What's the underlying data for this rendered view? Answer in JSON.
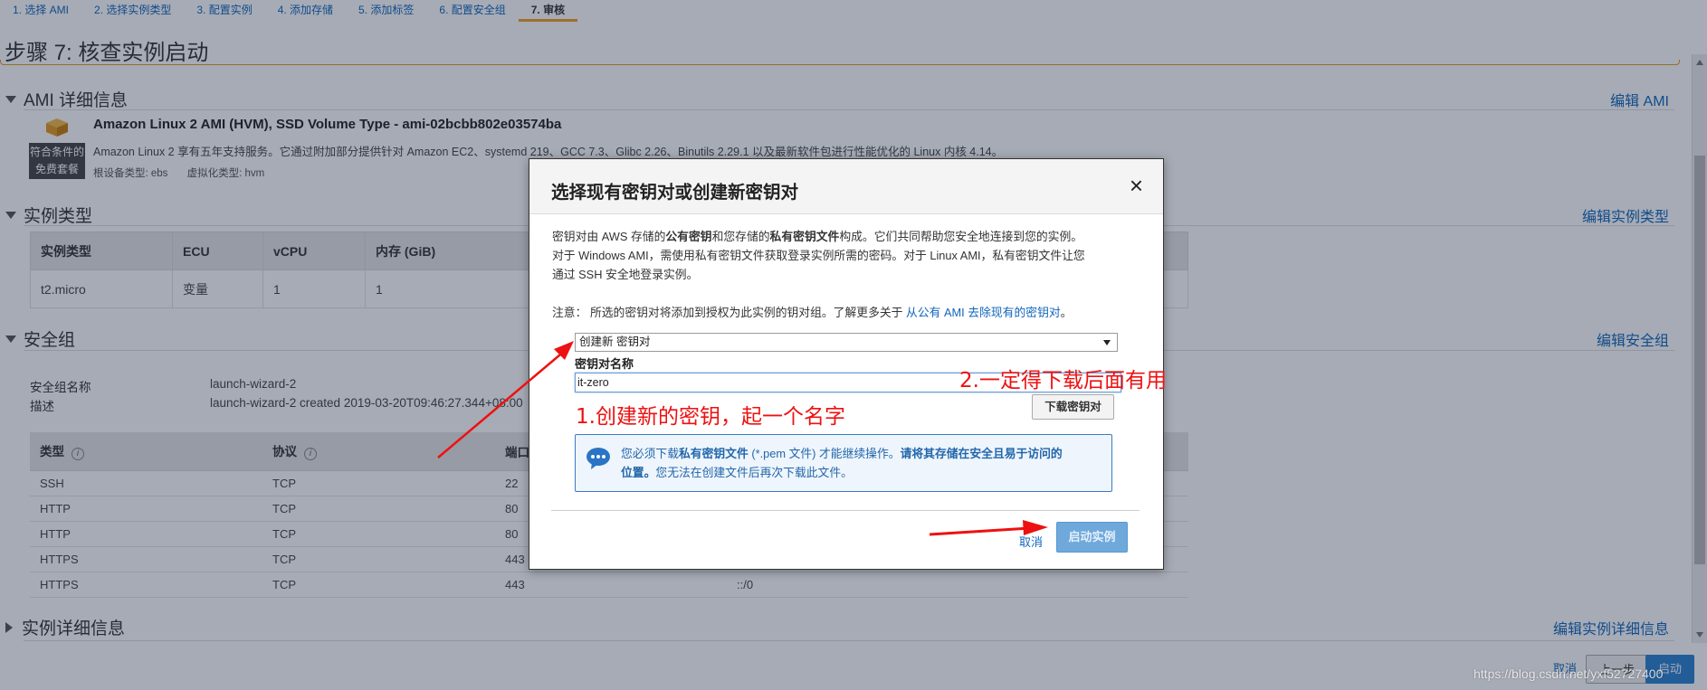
{
  "tabs": [
    "1. 选择 AMI",
    "2. 选择实例类型",
    "3. 配置实例",
    "4. 添加存储",
    "5. 添加标签",
    "6. 配置安全组",
    "7. 审核"
  ],
  "page_title": "步骤 7: 核查实例启动",
  "ami": {
    "heading": "AMI 详细信息",
    "edit_link": "编辑 AMI",
    "badge_line1": "符合条件的",
    "badge_line2": "免费套餐",
    "name": "Amazon Linux 2 AMI (HVM), SSD Volume Type - ami-02bcbb802e03574ba",
    "description": "Amazon Linux 2 享有五年支持服务。它通过附加部分提供针对 Amazon EC2、systemd 219、GCC 7.3、Glibc 2.26、Binutils 2.29.1 以及最新软件包进行性能优化的 Linux 内核 4.14。",
    "root_device": "根设备类型: ebs",
    "virtualization": "虚拟化类型: hvm"
  },
  "instance_type": {
    "heading": "实例类型",
    "edit_link": "编辑实例类型",
    "columns": [
      "实例类型",
      "ECU",
      "vCPU",
      "内存 (GiB)"
    ],
    "row": [
      "t2.micro",
      "变量",
      "1",
      "1"
    ]
  },
  "security_group": {
    "heading": "安全组",
    "edit_link": "编辑安全组",
    "name_label": "安全组名称",
    "name_value": "launch-wizard-2",
    "desc_label": "描述",
    "desc_value": "launch-wizard-2 created 2019-03-20T09:46:27.344+08:00",
    "columns": [
      "类型",
      "协议",
      "端口"
    ],
    "rows": [
      [
        "SSH",
        "TCP",
        "22",
        ""
      ],
      [
        "HTTP",
        "TCP",
        "80",
        ""
      ],
      [
        "HTTP",
        "TCP",
        "80",
        ""
      ],
      [
        "HTTPS",
        "TCP",
        "443",
        ""
      ],
      [
        "HTTPS",
        "TCP",
        "443",
        "::/0"
      ]
    ]
  },
  "instance_details": {
    "heading": "实例详细信息",
    "edit_link": "编辑实例详细信息"
  },
  "footer": {
    "cancel": "取消",
    "prev": "上一步",
    "launch": "启动"
  },
  "modal": {
    "title": "选择现有密钥对或创建新密钥对",
    "close": "×",
    "para1_a": "密钥对由 AWS 存储的",
    "para1_b": "公有密钥",
    "para1_c": "和您存储的",
    "para1_d": "私有密钥文件",
    "para1_e": "构成。它们共同帮助您安全地连接到您的实例。",
    "para1_line2": "对于 Windows AMI，需使用私有密钥文件获取登录实例所需的密码。对于 Linux AMI，私有密钥文件让您",
    "para1_line3": "通过 SSH 安全地登录实例。",
    "note": "注意： 所选的密钥对将添加到授权为此实例的钥对组。了解更多关于 ",
    "note_link": "从公有 AMI 去除现有的密钥对",
    "note_end": "。",
    "select_value": "创建新 密钥对",
    "field_label": "密钥对名称",
    "key_name": "it-zero",
    "download_button": "下载密钥对",
    "alert_a": "您必须下载",
    "alert_b": "私有密钥文件",
    "alert_c": " (*.pem 文件) 才能继续操作。",
    "alert_d": "请将其存储在安全且易于访问的",
    "alert_e": "位置。",
    "alert_f": "您无法在创建文件后再次下载此文件。",
    "cancel": "取消",
    "launch": "启动实例"
  },
  "annotations": {
    "step1": "1.创建新的密钥，起一个名字",
    "step2": "2.一定得下载后面有用"
  },
  "watermark": "https://blog.csdn.net/yxf52727400",
  "colors": {
    "link": "#1166bb",
    "active_tab": "#f0a020",
    "annotation": "#ee1111",
    "primary_button": "#6fa9dc"
  }
}
